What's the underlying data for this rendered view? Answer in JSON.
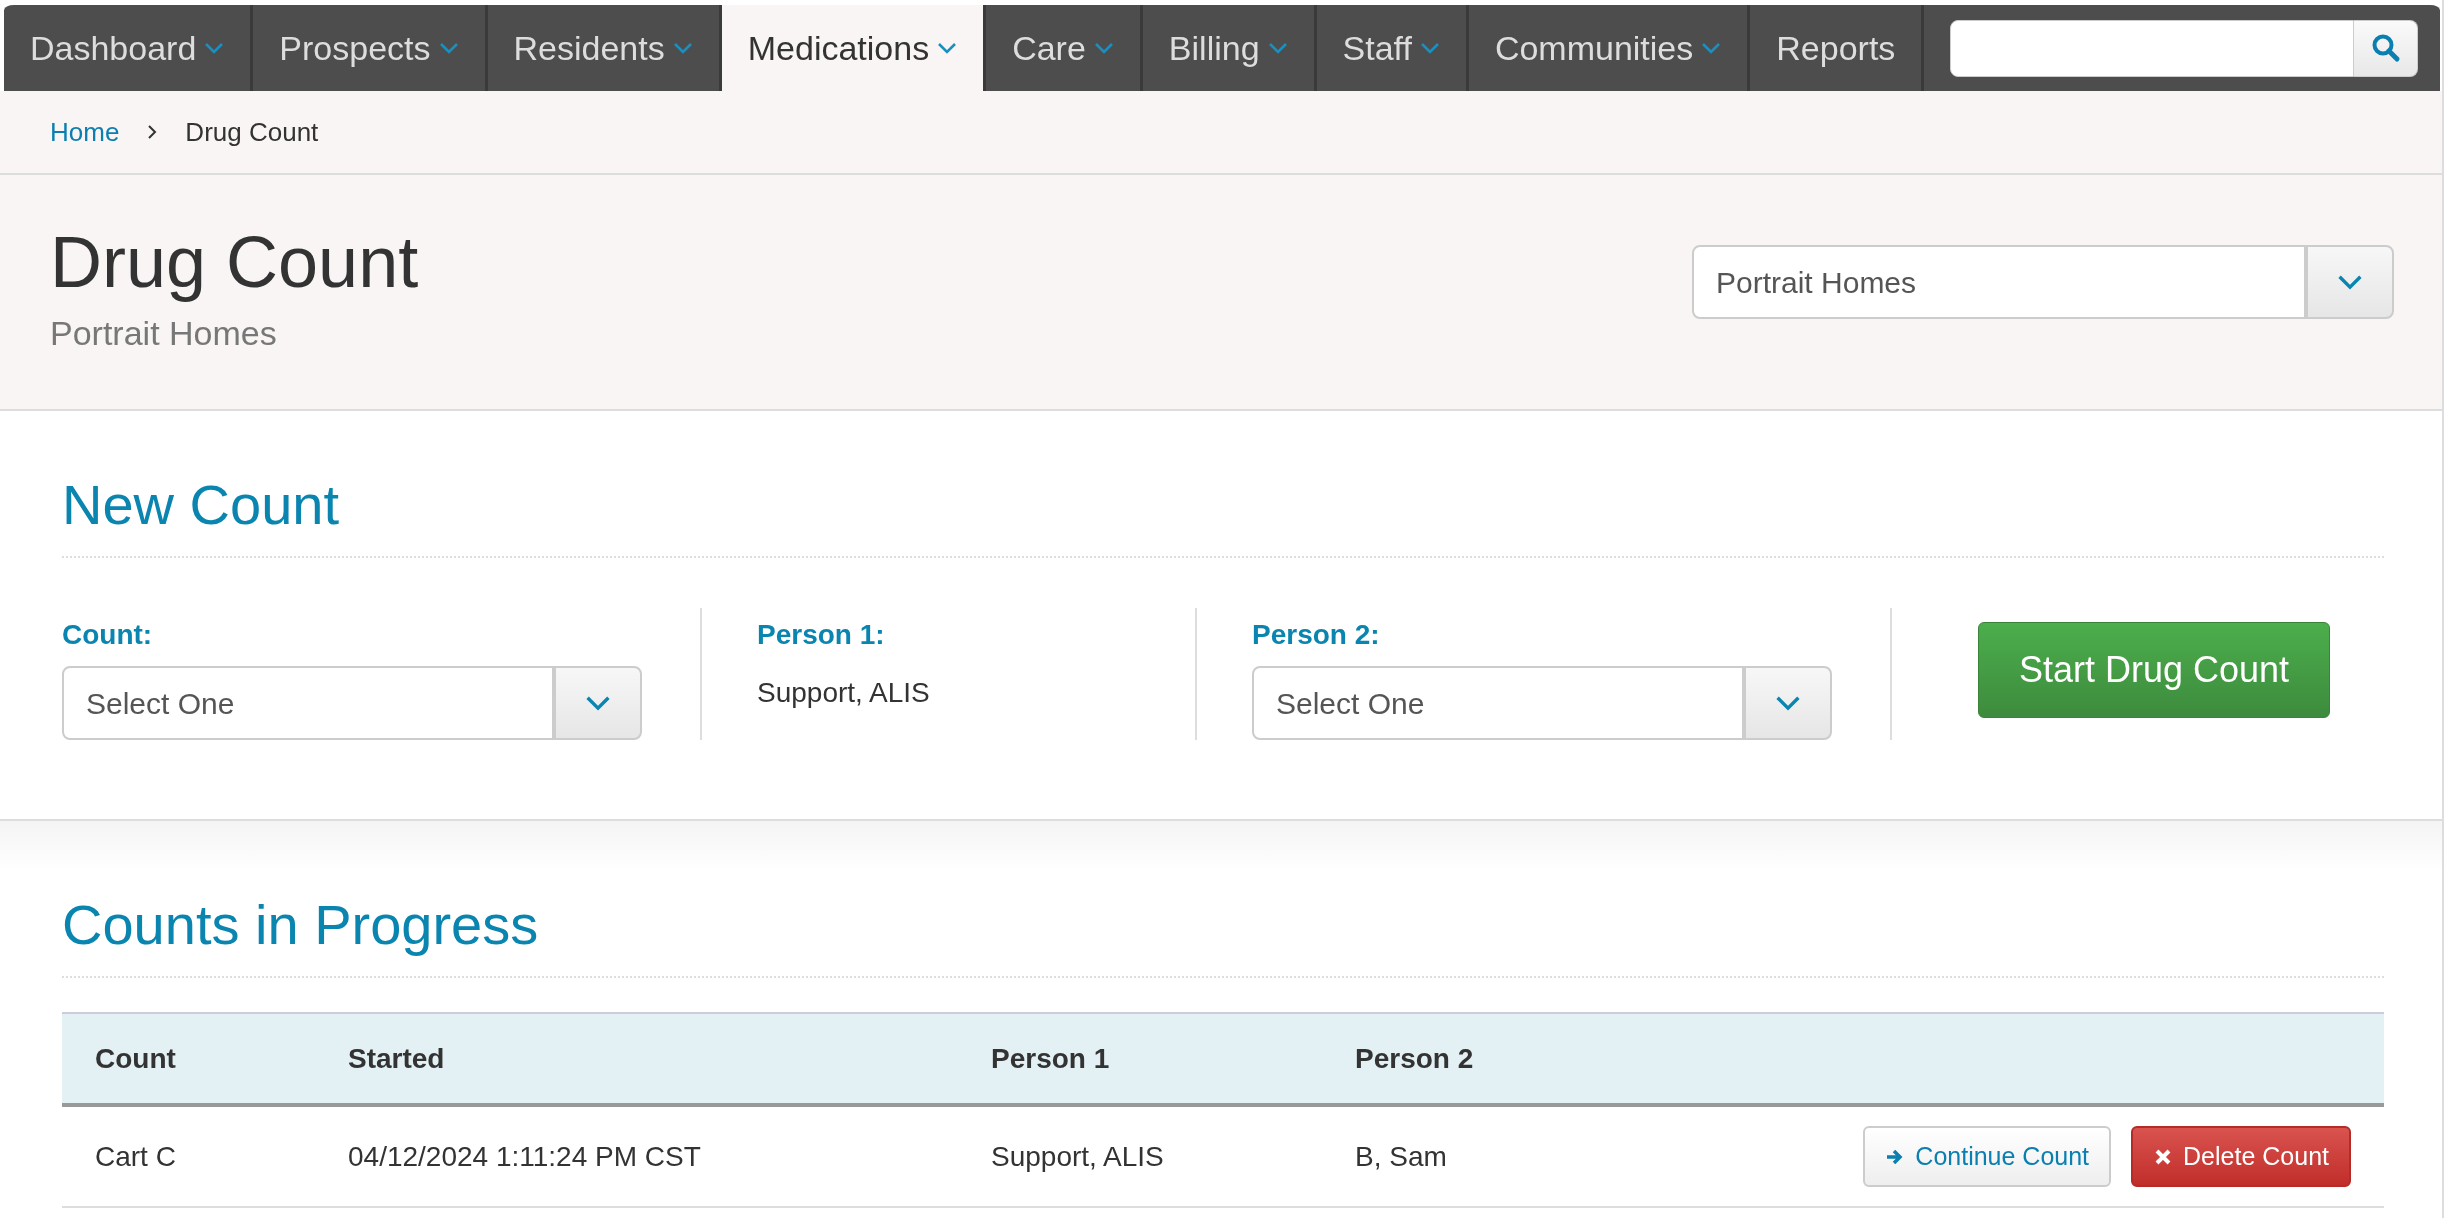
{
  "nav": {
    "items": [
      {
        "label": "Dashboard",
        "has_menu": true,
        "selected": false
      },
      {
        "label": "Prospects",
        "has_menu": true,
        "selected": false
      },
      {
        "label": "Residents",
        "has_menu": true,
        "selected": false
      },
      {
        "label": "Medications",
        "has_menu": true,
        "selected": true
      },
      {
        "label": "Care",
        "has_menu": true,
        "selected": false
      },
      {
        "label": "Billing",
        "has_menu": true,
        "selected": false
      },
      {
        "label": "Staff",
        "has_menu": true,
        "selected": false
      },
      {
        "label": "Communities",
        "has_menu": true,
        "selected": false
      },
      {
        "label": "Reports",
        "has_menu": false,
        "selected": false
      }
    ]
  },
  "breadcrumb": [
    {
      "label": "Home",
      "link": true
    },
    {
      "label": "Drug Count",
      "link": false
    }
  ],
  "header": {
    "title": "Drug Count",
    "subtitle": "Portrait Homes",
    "community_select": "Portrait Homes"
  },
  "new_count": {
    "heading": "New Count",
    "fields": [
      {
        "kind": "select",
        "label": "Count:",
        "value": "Select One"
      },
      {
        "kind": "text",
        "label": "Person 1:",
        "value": "Support, ALIS"
      },
      {
        "kind": "select",
        "label": "Person 2:",
        "value": "Select One"
      }
    ],
    "start_button": "Start Drug Count"
  },
  "counts_in_progress": {
    "heading": "Counts in Progress",
    "columns": [
      "Count",
      "Started",
      "Person 1",
      "Person 2"
    ],
    "rows": [
      {
        "cells": [
          "Cart C",
          "04/12/2024 1:11:24 PM CST",
          "Support, ALIS",
          "B, Sam"
        ],
        "actions": [
          {
            "kind": "continue",
            "label": "Continue Count"
          },
          {
            "kind": "delete",
            "label": "Delete Count"
          }
        ]
      }
    ]
  }
}
